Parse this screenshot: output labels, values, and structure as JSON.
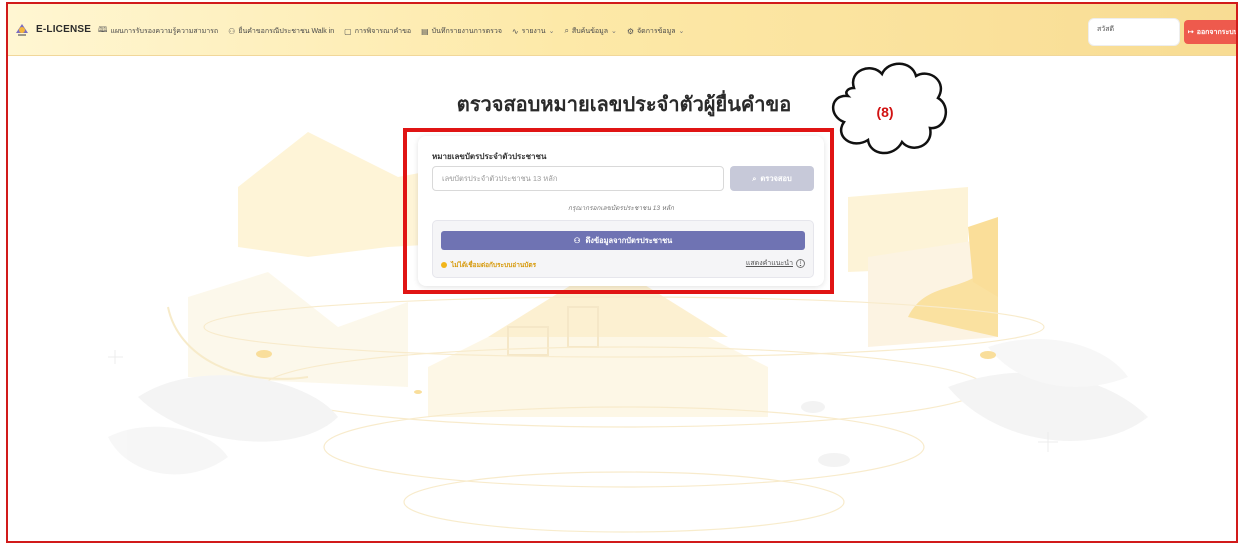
{
  "brand": {
    "name": "E-LICENSE"
  },
  "nav": [
    {
      "icon": "book-open-icon",
      "glyph": "🕮",
      "label": "แผนการรับรองความรู้ความสามารถ",
      "dropdown": false
    },
    {
      "icon": "user-plus-icon",
      "glyph": "⚇",
      "label": "ยื่นคำขอกรณีประชาชน Walk in",
      "dropdown": false
    },
    {
      "icon": "clipboard-icon",
      "glyph": "▢",
      "label": "การพิจารณาคำขอ",
      "dropdown": false
    },
    {
      "icon": "document-icon",
      "glyph": "▤",
      "label": "บันทึกรายงานการตรวจ",
      "dropdown": false
    },
    {
      "icon": "activity-icon",
      "glyph": "∿",
      "label": "รายงาน",
      "dropdown": true
    },
    {
      "icon": "search-icon",
      "glyph": "⌕",
      "label": "สืบค้นข้อมูล",
      "dropdown": true
    },
    {
      "icon": "settings-icon",
      "glyph": "⚙",
      "label": "จัดการข้อมูล",
      "dropdown": true
    }
  ],
  "user": {
    "greeting": "สวัสดี",
    "name": ""
  },
  "logout": {
    "label": "ออกจากระบบ",
    "icon": "logout-icon"
  },
  "page": {
    "title": "ตรวจสอบหมายเลขประจำตัวผู้ยื่นคำขอ"
  },
  "form": {
    "label": "หมายเลขบัตรประจำตัวประชาชน",
    "placeholder": "เลขบัตรประจำตัวประชาชน 13 หลัก",
    "value": "",
    "check_label": "ตรวจสอบ",
    "hint": "กรุณากรอกเลขบัตรประชาชน 13 หลัก"
  },
  "card_reader": {
    "button_label": "ดึงข้อมูลจากบัตรประชาชน",
    "status": "ไม่ได้เชื่อมต่อกับระบบอ่านบัตร",
    "status_color": "#f2b51b",
    "guide_label": "แสดงคำแนะนำ"
  },
  "annotation": {
    "label": "(8)"
  },
  "colors": {
    "accent": "#6f73b3",
    "logout": "#ee5a4d",
    "highlight": "#e01414"
  }
}
